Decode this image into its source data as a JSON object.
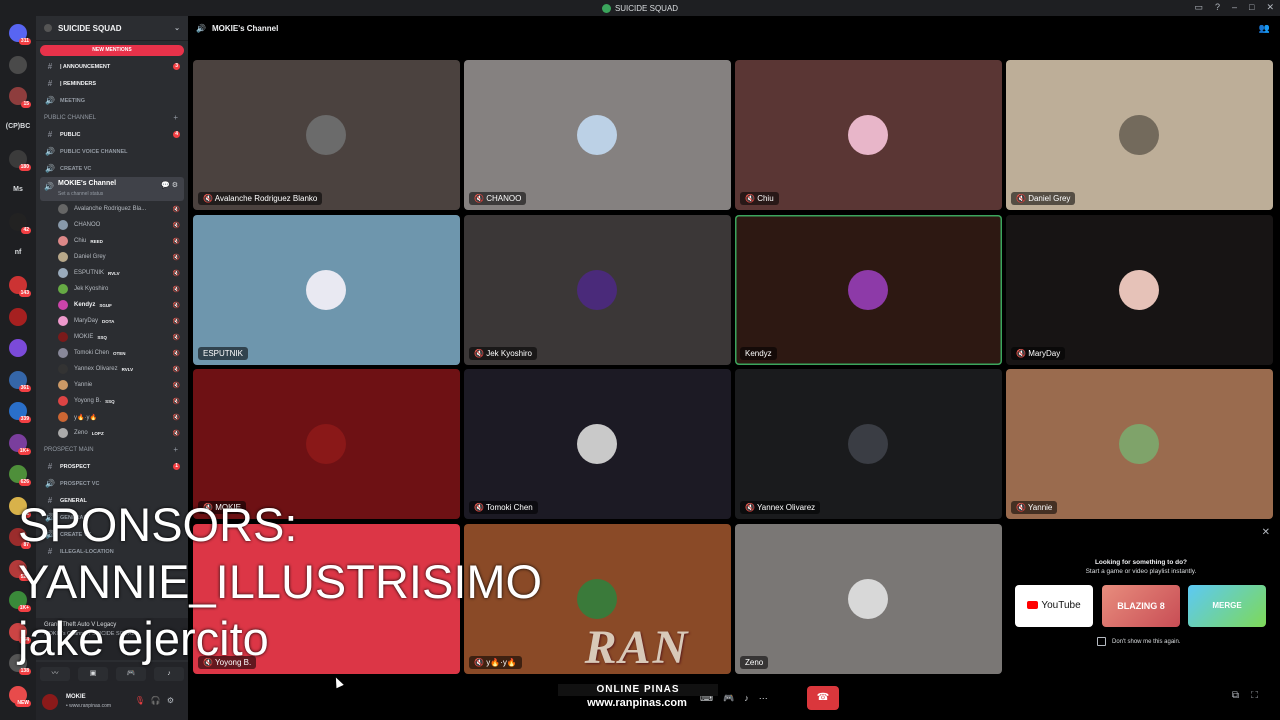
{
  "window": {
    "title": "SUICIDE SQUAD"
  },
  "rail": {
    "items": [
      {
        "badge": "311",
        "color": "#5865f2"
      },
      {
        "badge": "",
        "color": "#4a4a4a"
      },
      {
        "badge": "15",
        "color": "#8e3d3d"
      },
      {
        "label": "(CP)BC",
        "badge": ""
      },
      {
        "badge": "180",
        "color": "#3b3b3b"
      },
      {
        "label": "Ms",
        "badge": ""
      },
      {
        "badge": "42",
        "color": "#222"
      },
      {
        "label": "nf",
        "badge": ""
      },
      {
        "badge": "143",
        "color": "#c33"
      },
      {
        "badge": "",
        "color": "#a62020"
      },
      {
        "badge": "",
        "color": "#7b4ad9"
      },
      {
        "badge": "361",
        "color": "#3566a8"
      },
      {
        "badge": "339",
        "color": "#2a6fc9"
      },
      {
        "badge": "1K+",
        "color": "#7a3e9d"
      },
      {
        "badge": "626",
        "color": "#4e8f3a"
      },
      {
        "badge": "11",
        "color": "#d8b24a"
      },
      {
        "badge": "87",
        "color": "#9b2c2c"
      },
      {
        "badge": "521",
        "color": "#b33a3a"
      },
      {
        "badge": "1K+",
        "color": "#3a8a3a"
      },
      {
        "badge": "754",
        "color": "#c44"
      },
      {
        "badge": "138",
        "color": "#555"
      },
      {
        "badge": "NEW",
        "color": "#e84b4b"
      }
    ]
  },
  "sidebar": {
    "guild_name": "SUICIDE SQUAD",
    "new_mentions": "NEW MENTIONS",
    "channels_top": [
      {
        "sym": "#",
        "name": "| ANNOUNCEMENT",
        "unread": true,
        "count": "3"
      },
      {
        "sym": "#",
        "name": "| REMINDERS",
        "unread": true,
        "count": ""
      },
      {
        "sym": "🔊",
        "name": "MEETING",
        "unread": false,
        "count": ""
      }
    ],
    "category_public": "PUBLIC CHANNEL",
    "channels_public": [
      {
        "sym": "#",
        "name": "PUBLIC",
        "unread": true,
        "count": "4"
      },
      {
        "sym": "🔊",
        "name": "PUBLIC VOICE CHANNEL",
        "unread": false,
        "count": ""
      },
      {
        "sym": "🔊",
        "name": "CREATE VC",
        "unread": false,
        "count": ""
      }
    ],
    "current_channel": {
      "name": "MOKIE's Channel",
      "status": "Set a channel status"
    },
    "voice_users": [
      {
        "name": "Avalanche Rodriguez Bla...",
        "tag": "",
        "color": "#666",
        "bold": false
      },
      {
        "name": "CHANOO",
        "tag": "",
        "color": "#8899aa",
        "bold": false
      },
      {
        "name": "Chiu",
        "tag": "REED",
        "color": "#d88",
        "bold": false
      },
      {
        "name": "Daniel Grey",
        "tag": "",
        "color": "#b8a88a",
        "bold": false
      },
      {
        "name": "ESPUTNIK",
        "tag": "RVLV",
        "color": "#9ab",
        "bold": false
      },
      {
        "name": "Jek Kyoshiro",
        "tag": "",
        "color": "#6a4",
        "bold": false
      },
      {
        "name": "Kendyz",
        "tag": "SGUF",
        "color": "#c4a",
        "bold": true
      },
      {
        "name": "MaryDay",
        "tag": "DOTA",
        "color": "#e9c",
        "bold": false
      },
      {
        "name": "MOKIE",
        "tag": "SSQ",
        "color": "#7a1a1a",
        "bold": false
      },
      {
        "name": "Tomoki Chen",
        "tag": "OTEN",
        "color": "#889",
        "bold": false
      },
      {
        "name": "Yannex Olivarez",
        "tag": "RVLV",
        "color": "#333",
        "bold": false
      },
      {
        "name": "Yannie",
        "tag": "",
        "color": "#c96",
        "bold": false
      },
      {
        "name": "Yoyong B.",
        "tag": "SSQ",
        "color": "#d44",
        "bold": false
      },
      {
        "name": "y🔥·y🔥",
        "tag": "",
        "color": "#c63",
        "bold": false
      },
      {
        "name": "Zeno",
        "tag": "LOPZ",
        "color": "#aaa",
        "bold": false
      }
    ],
    "category_prospect": "PROSPECT MAIN",
    "channels_prospect": [
      {
        "sym": "#",
        "name": "PROSPECT",
        "unread": true,
        "count": "1"
      },
      {
        "sym": "🔊",
        "name": "PROSPECT VC",
        "unread": false,
        "count": ""
      }
    ],
    "channels_more": [
      {
        "sym": "#",
        "name": "GENERAL",
        "unread": true,
        "count": ""
      },
      {
        "sym": "🔊",
        "name": "GENERAL",
        "unread": false,
        "count": ""
      },
      {
        "sym": "🔊",
        "name": "CREATE VC",
        "unread": false,
        "count": ""
      },
      {
        "sym": "#",
        "name": "ILLEGAL-LOCATION",
        "unread": false,
        "count": ""
      }
    ],
    "activity": {
      "game": "Grand Theft Auto V Legacy",
      "location": "MOKIE's Channel / SUICIDE SQUAD"
    },
    "user": {
      "name": "MOKIE",
      "status": "• www.ranpinas.com"
    }
  },
  "stage": {
    "channel_name": "MOKIE's Channel",
    "tiles": [
      {
        "name": "Avalanche Rodriguez Blanko",
        "bg": "#4b423f",
        "av": "#6b6b6b",
        "muted": true,
        "speaking": false
      },
      {
        "name": "CHANOO",
        "bg": "#858180",
        "av": "#bcd1e6",
        "muted": true,
        "speaking": false
      },
      {
        "name": "Chiu",
        "bg": "#5a3634",
        "av": "#e8b6c9",
        "muted": true,
        "speaking": false
      },
      {
        "name": "Daniel Grey",
        "bg": "#bdae98",
        "av": "#736a5c",
        "muted": true,
        "speaking": false
      },
      {
        "name": "ESPUTNIK",
        "bg": "#6e96ad",
        "av": "#e9e9f2",
        "muted": false,
        "speaking": false
      },
      {
        "name": "Jek Kyoshiro",
        "bg": "#3b3737",
        "av": "#4a2a7a",
        "muted": true,
        "speaking": false
      },
      {
        "name": "Kendyz",
        "bg": "#2d1812",
        "av": "#8d3aa8",
        "muted": false,
        "speaking": true
      },
      {
        "name": "MaryDay",
        "bg": "#171414",
        "av": "#e6c2b8",
        "muted": true,
        "speaking": false
      },
      {
        "name": "MOKIE",
        "bg": "#6e1114",
        "av": "#8a1818",
        "muted": true,
        "speaking": false
      },
      {
        "name": "Tomoki Chen",
        "bg": "#1c1a24",
        "av": "#c9c9c9",
        "muted": true,
        "speaking": false
      },
      {
        "name": "Yannex Olivarez",
        "bg": "#1a1b1d",
        "av": "#3a3d44",
        "muted": true,
        "speaking": false
      },
      {
        "name": "Yannie",
        "bg": "#9a6b4e",
        "av": "#7fa36a",
        "muted": true,
        "speaking": false
      },
      {
        "name": "Yoyong B.",
        "bg": "#dc3646",
        "av": "#dc3646",
        "muted": true,
        "speaking": false
      },
      {
        "name": "y🔥·y🔥",
        "bg": "#8a4a27",
        "av": "#3a7a3a",
        "muted": true,
        "speaking": false
      },
      {
        "name": "Zeno",
        "bg": "#7a7775",
        "av": "#d8d8d8",
        "muted": false,
        "speaking": false
      }
    ],
    "promo": {
      "title": "Looking for something to do?",
      "subtitle": "Start a game or video playlist instantly.",
      "cards": [
        "YouTube",
        "BLAZING 8",
        "MERGE"
      ],
      "dont_show": "Don't show me this again."
    }
  },
  "overlay": {
    "line1": "SPONSORS:",
    "line2": "YANNIE_ILLUSTRISIMO",
    "line3": "jake ejercito"
  },
  "watermark": {
    "brand": "RAN",
    "tagline": "ONLINE PINAS",
    "url": "www.ranpinas.com"
  }
}
